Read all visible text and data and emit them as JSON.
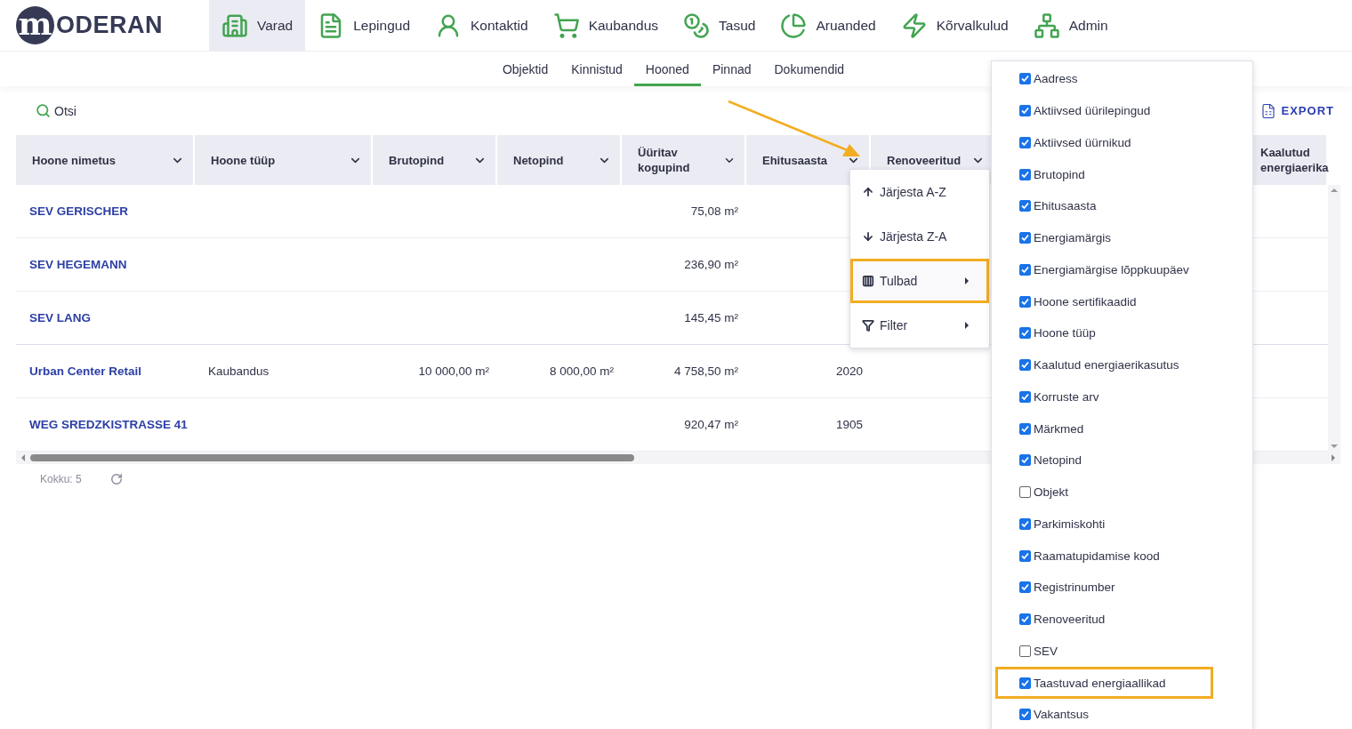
{
  "logo": {
    "mark": "m",
    "text": "ODERAN"
  },
  "nav": [
    {
      "label": "Varad",
      "selected": true
    },
    {
      "label": "Lepingud",
      "selected": false
    },
    {
      "label": "Kontaktid",
      "selected": false
    },
    {
      "label": "Kaubandus",
      "selected": false
    },
    {
      "label": "Tasud",
      "selected": false
    },
    {
      "label": "Aruanded",
      "selected": false
    },
    {
      "label": "Kõrvalkulud",
      "selected": false
    },
    {
      "label": "Admin",
      "selected": false
    }
  ],
  "subnav": [
    {
      "label": "Objektid",
      "selected": false
    },
    {
      "label": "Kinnistud",
      "selected": false
    },
    {
      "label": "Hooned",
      "selected": true
    },
    {
      "label": "Pinnad",
      "selected": false
    },
    {
      "label": "Dokumendid",
      "selected": false
    }
  ],
  "toolbar": {
    "search": "Otsi",
    "export": "EXPORT"
  },
  "table": {
    "columns": [
      {
        "label": "Hoone nimetus"
      },
      {
        "label": "Hoone tüüp"
      },
      {
        "label": "Brutopind"
      },
      {
        "label": "Netopind"
      },
      {
        "label": "Üüritav kogupind"
      },
      {
        "label": "Ehitusaasta"
      },
      {
        "label": "Renoveeritud"
      },
      {
        "label": "Kaalutud energiaerika"
      }
    ],
    "rows": [
      {
        "name": "SEV GERISCHER",
        "uuritav_kogupind": "75,08 m²"
      },
      {
        "name": "SEV HEGEMANN",
        "uuritav_kogupind": "236,90 m²"
      },
      {
        "name": "SEV LANG",
        "uuritav_kogupind": "145,45 m²"
      },
      {
        "name": "Urban Center Retail",
        "hoone_tuup": "Kaubandus",
        "brutopind": "10 000,00 m²",
        "netopind": "8 000,00 m²",
        "uuritav_kogupind": "4 758,50 m²",
        "ehitusaasta": "2020"
      },
      {
        "name": "WEG SREDZKISTRASSE 41",
        "uuritav_kogupind": "920,47 m²",
        "ehitusaasta": "1905"
      }
    ]
  },
  "footer": {
    "total": "Kokku: 5"
  },
  "column_menu": [
    {
      "label": "Järjesta A-Z",
      "submenu": false,
      "highlighted": false
    },
    {
      "label": "Järjesta Z-A",
      "submenu": false,
      "highlighted": false
    },
    {
      "label": "Tulbad",
      "submenu": true,
      "highlighted": true
    },
    {
      "label": "Filter",
      "submenu": true,
      "highlighted": false
    }
  ],
  "columns_chooser": [
    {
      "label": "Aadress",
      "checked": true,
      "highlighted": false
    },
    {
      "label": "Aktiivsed üürilepingud",
      "checked": true,
      "highlighted": false
    },
    {
      "label": "Aktiivsed üürnikud",
      "checked": true,
      "highlighted": false
    },
    {
      "label": "Brutopind",
      "checked": true,
      "highlighted": false
    },
    {
      "label": "Ehitusaasta",
      "checked": true,
      "highlighted": false
    },
    {
      "label": "Energiamärgis",
      "checked": true,
      "highlighted": false
    },
    {
      "label": "Energiamärgise lõppkuupäev",
      "checked": true,
      "highlighted": false
    },
    {
      "label": "Hoone sertifikaadid",
      "checked": true,
      "highlighted": false
    },
    {
      "label": "Hoone tüüp",
      "checked": true,
      "highlighted": false
    },
    {
      "label": "Kaalutud energiaerikasutus",
      "checked": true,
      "highlighted": false
    },
    {
      "label": "Korruste arv",
      "checked": true,
      "highlighted": false
    },
    {
      "label": "Märkmed",
      "checked": true,
      "highlighted": false
    },
    {
      "label": "Netopind",
      "checked": true,
      "highlighted": false
    },
    {
      "label": "Objekt",
      "checked": false,
      "highlighted": false
    },
    {
      "label": "Parkimiskohti",
      "checked": true,
      "highlighted": false
    },
    {
      "label": "Raamatupidamise kood",
      "checked": true,
      "highlighted": false
    },
    {
      "label": "Registrinumber",
      "checked": true,
      "highlighted": false
    },
    {
      "label": "Renoveeritud",
      "checked": true,
      "highlighted": false
    },
    {
      "label": "SEV",
      "checked": false,
      "highlighted": false
    },
    {
      "label": "Taastuvad energiaallikad",
      "checked": true,
      "highlighted": true
    },
    {
      "label": "Vakantsus",
      "checked": true,
      "highlighted": false
    }
  ]
}
